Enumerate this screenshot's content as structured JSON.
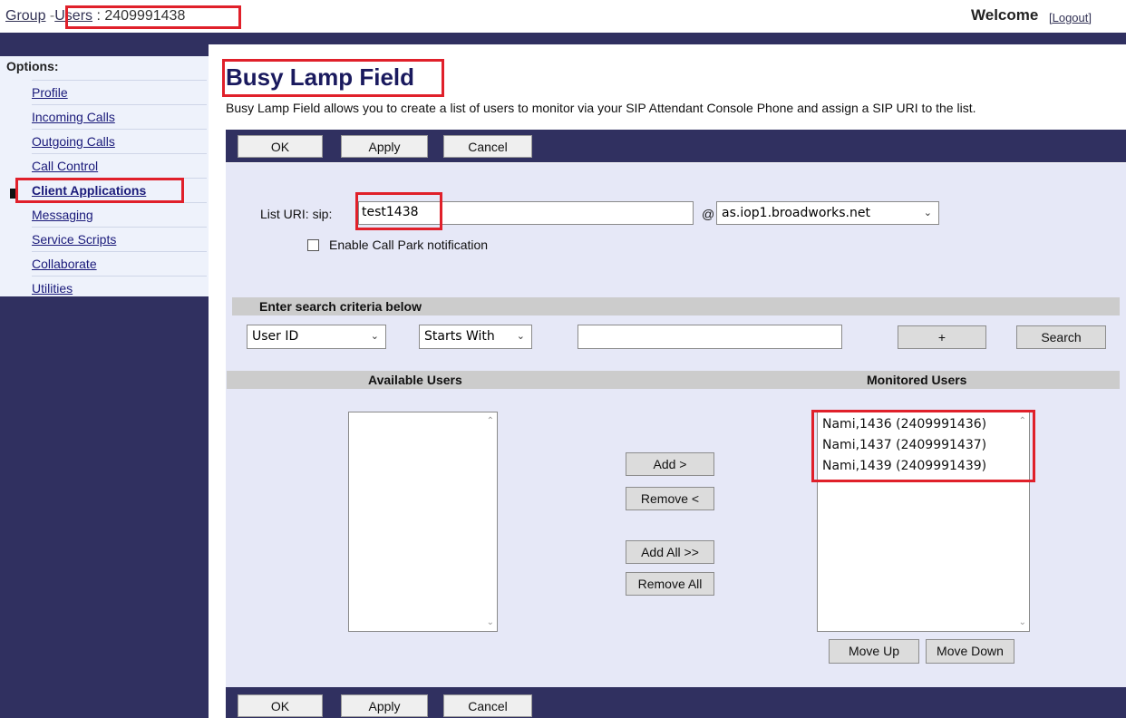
{
  "header": {
    "breadcrumb_group": "Group",
    "breadcrumb_sep": "-",
    "breadcrumb_users": "Users",
    "breadcrumb_user_id": " : 2409991438",
    "welcome": "Welcome",
    "logout": "[Logout]"
  },
  "sidebar": {
    "options_label": "Options:",
    "items": [
      {
        "label": "Profile"
      },
      {
        "label": "Incoming Calls"
      },
      {
        "label": "Outgoing Calls"
      },
      {
        "label": "Call Control"
      },
      {
        "label": "Client Applications"
      },
      {
        "label": "Messaging"
      },
      {
        "label": "Service Scripts"
      },
      {
        "label": "Collaborate"
      },
      {
        "label": "Utilities"
      }
    ]
  },
  "page": {
    "title": "Busy Lamp Field",
    "description": "Busy Lamp Field allows you to create a list of users to monitor via your SIP Attendant Console Phone and assign a SIP URI to the list."
  },
  "toolbar": {
    "ok": "OK",
    "apply": "Apply",
    "cancel": "Cancel"
  },
  "form": {
    "list_uri_label": "List URI: sip:",
    "list_uri_value": "test1438",
    "at_sign": "@",
    "domain_selected": "as.iop1.broadworks.net",
    "call_park_label": "Enable Call Park notification"
  },
  "search": {
    "band_title": "Enter search criteria below",
    "field_selected": "User ID",
    "mode_selected": "Starts With",
    "query_value": "",
    "plus_label": "+",
    "search_label": "Search"
  },
  "lists": {
    "available_title": "Available Users",
    "monitored_title": "Monitored Users",
    "available_users": [],
    "monitored_users": [
      "Nami,1436 (2409991436)",
      "Nami,1437 (2409991437)",
      "Nami,1439 (2409991439)"
    ],
    "add": "Add >",
    "remove": "Remove <",
    "add_all": "Add All >>",
    "remove_all": "Remove All",
    "move_up": "Move Up",
    "move_down": "Move Down"
  },
  "colors": {
    "nav_dark": "#303060",
    "panel": "#e6e8f7",
    "highlight": "#e0202a"
  }
}
